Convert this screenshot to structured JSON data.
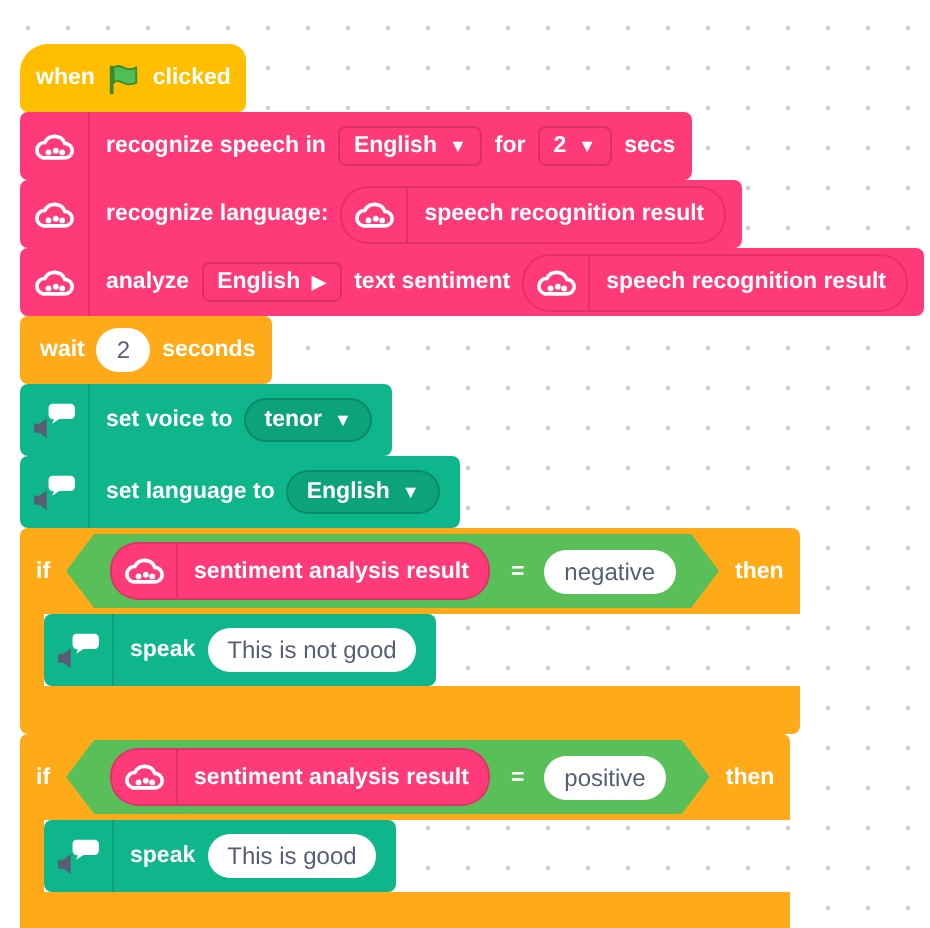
{
  "blocks": [
    {
      "kind": "hat",
      "parts": [
        {
          "kind": "text",
          "text": "when"
        },
        {
          "kind": "flag"
        },
        {
          "kind": "text",
          "text": "clicked"
        }
      ]
    },
    {
      "kind": "ai",
      "parts": [
        {
          "kind": "text",
          "text": "recognize speech in"
        },
        {
          "kind": "dropdown",
          "text": "English",
          "arrow": "▼"
        },
        {
          "kind": "text",
          "text": "for"
        },
        {
          "kind": "dropdown",
          "text": "2",
          "arrow": "▼"
        },
        {
          "kind": "text",
          "text": "secs"
        }
      ]
    },
    {
      "kind": "ai",
      "parts": [
        {
          "kind": "text",
          "text": "recognize language:"
        },
        {
          "kind": "reporter",
          "text": "speech recognition result"
        }
      ]
    },
    {
      "kind": "ai",
      "parts": [
        {
          "kind": "text",
          "text": "analyze"
        },
        {
          "kind": "dropdown",
          "text": "English",
          "arrow": "▶"
        },
        {
          "kind": "text",
          "text": "text sentiment"
        },
        {
          "kind": "reporter",
          "text": "speech recognition result"
        }
      ]
    },
    {
      "kind": "control",
      "parts": [
        {
          "kind": "text",
          "text": "wait"
        },
        {
          "kind": "input",
          "text": "2"
        },
        {
          "kind": "text",
          "text": "seconds"
        }
      ]
    },
    {
      "kind": "voice",
      "parts": [
        {
          "kind": "text",
          "text": "set voice to"
        },
        {
          "kind": "dropdown",
          "text": "tenor",
          "arrow": "▼"
        }
      ]
    },
    {
      "kind": "voice",
      "parts": [
        {
          "kind": "text",
          "text": "set language to"
        },
        {
          "kind": "dropdown",
          "text": "English",
          "arrow": "▼"
        }
      ]
    },
    {
      "kind": "if",
      "parts": [
        {
          "kind": "text",
          "text": "if"
        },
        {
          "kind": "compare",
          "left": {
            "kind": "reporter",
            "text": "sentiment analysis result"
          },
          "op": "=",
          "right": {
            "kind": "input",
            "text": "negative"
          }
        },
        {
          "kind": "text",
          "text": "then"
        }
      ],
      "body": [
        {
          "kind": "voice",
          "parts": [
            {
              "kind": "text",
              "text": "speak"
            },
            {
              "kind": "input",
              "text": "This is not good"
            }
          ]
        }
      ]
    },
    {
      "kind": "if",
      "parts": [
        {
          "kind": "text",
          "text": "if"
        },
        {
          "kind": "compare",
          "left": {
            "kind": "reporter",
            "text": "sentiment analysis result"
          },
          "op": "=",
          "right": {
            "kind": "input",
            "text": "positive"
          }
        },
        {
          "kind": "text",
          "text": "then"
        }
      ],
      "body": [
        {
          "kind": "voice",
          "parts": [
            {
              "kind": "text",
              "text": "speak"
            },
            {
              "kind": "input",
              "text": "This is good"
            }
          ]
        }
      ]
    }
  ]
}
